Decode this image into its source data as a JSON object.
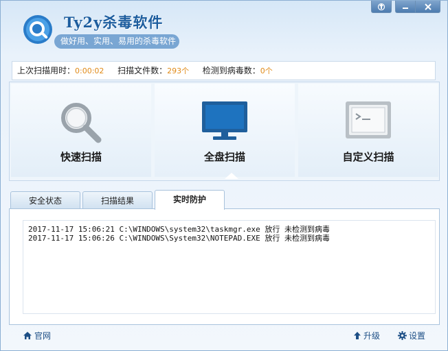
{
  "app": {
    "title": "Ty2y杀毒软件",
    "subtitle": "做好用、实用、易用的杀毒软件"
  },
  "window_controls": {
    "icons": [
      "skin-icon",
      "minimize-icon",
      "close-icon"
    ]
  },
  "stats": {
    "last_scan_label": "上次扫描用时：",
    "last_scan_value": "0:00:02",
    "files_label": "扫描文件数：",
    "files_value": "293个",
    "virus_label": "检测到病毒数：",
    "virus_value": "0个",
    "value_color": "#e08a17"
  },
  "scan_modes": [
    {
      "label": "快速扫描",
      "icon": "magnifier-icon"
    },
    {
      "label": "全盘扫描",
      "icon": "monitor-icon",
      "selected": true
    },
    {
      "label": "自定义扫描",
      "icon": "terminal-icon"
    }
  ],
  "tabs": [
    {
      "label": "安全状态"
    },
    {
      "label": "扫描结果"
    },
    {
      "label": "实时防护",
      "active": true
    }
  ],
  "log_lines": [
    "2017-11-17 15:06:21 C:\\WINDOWS\\system32\\taskmgr.exe 放行 未检测到病毒",
    "2017-11-17 15:06:26 C:\\WINDOWS\\System32\\NOTEPAD.EXE 放行 未检测到病毒"
  ],
  "footer": {
    "website_label": "官网",
    "upgrade_label": "升级",
    "settings_label": "设置"
  },
  "colors": {
    "brand_blue": "#1d5d9e",
    "accent_blue": "#2a6db3"
  }
}
